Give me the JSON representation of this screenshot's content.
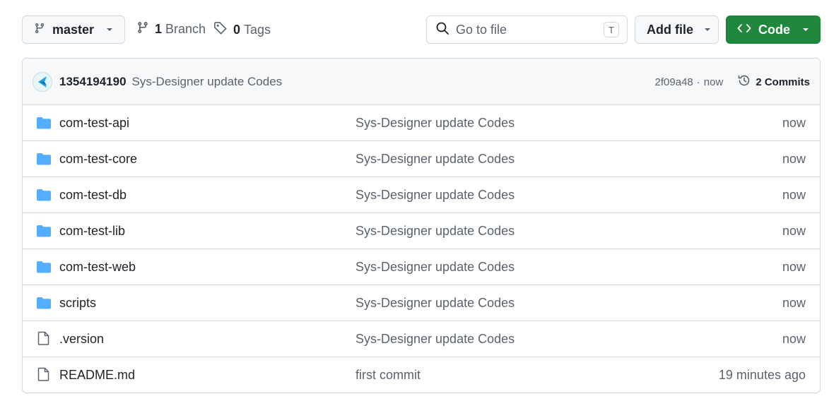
{
  "toolbar": {
    "branch_label": "master",
    "branches_count": "1",
    "branches_label": "Branch",
    "tags_count": "0",
    "tags_label": "Tags",
    "search_placeholder": "Go to file",
    "search_shortcut": "T",
    "add_file_label": "Add file",
    "code_label": "Code"
  },
  "latest_commit": {
    "author": "1354194190",
    "message": "Sys-Designer update Codes",
    "sha": "2f09a48",
    "separator": "·",
    "time": "now",
    "commits_label": "2 Commits"
  },
  "files": [
    {
      "name": "com-test-api",
      "type": "folder",
      "message": "Sys-Designer update Codes",
      "time": "now"
    },
    {
      "name": "com-test-core",
      "type": "folder",
      "message": "Sys-Designer update Codes",
      "time": "now"
    },
    {
      "name": "com-test-db",
      "type": "folder",
      "message": "Sys-Designer update Codes",
      "time": "now"
    },
    {
      "name": "com-test-lib",
      "type": "folder",
      "message": "Sys-Designer update Codes",
      "time": "now"
    },
    {
      "name": "com-test-web",
      "type": "folder",
      "message": "Sys-Designer update Codes",
      "time": "now"
    },
    {
      "name": "scripts",
      "type": "folder",
      "message": "Sys-Designer update Codes",
      "time": "now"
    },
    {
      "name": ".version",
      "type": "file",
      "message": "Sys-Designer update Codes",
      "time": "now"
    },
    {
      "name": "README.md",
      "type": "file",
      "message": "first commit",
      "time": "19 minutes ago"
    }
  ],
  "icons": {
    "branch": "git-branch-icon",
    "tag": "tag-icon",
    "search": "search-icon",
    "history": "history-icon",
    "code": "code-icon",
    "folder": "folder-icon",
    "file": "file-icon"
  },
  "colors": {
    "primary_green": "#1f883d",
    "folder_blue": "#54aeff",
    "border": "#d1d9e0",
    "muted_text": "#59636e",
    "header_bg": "#f6f8fa"
  }
}
